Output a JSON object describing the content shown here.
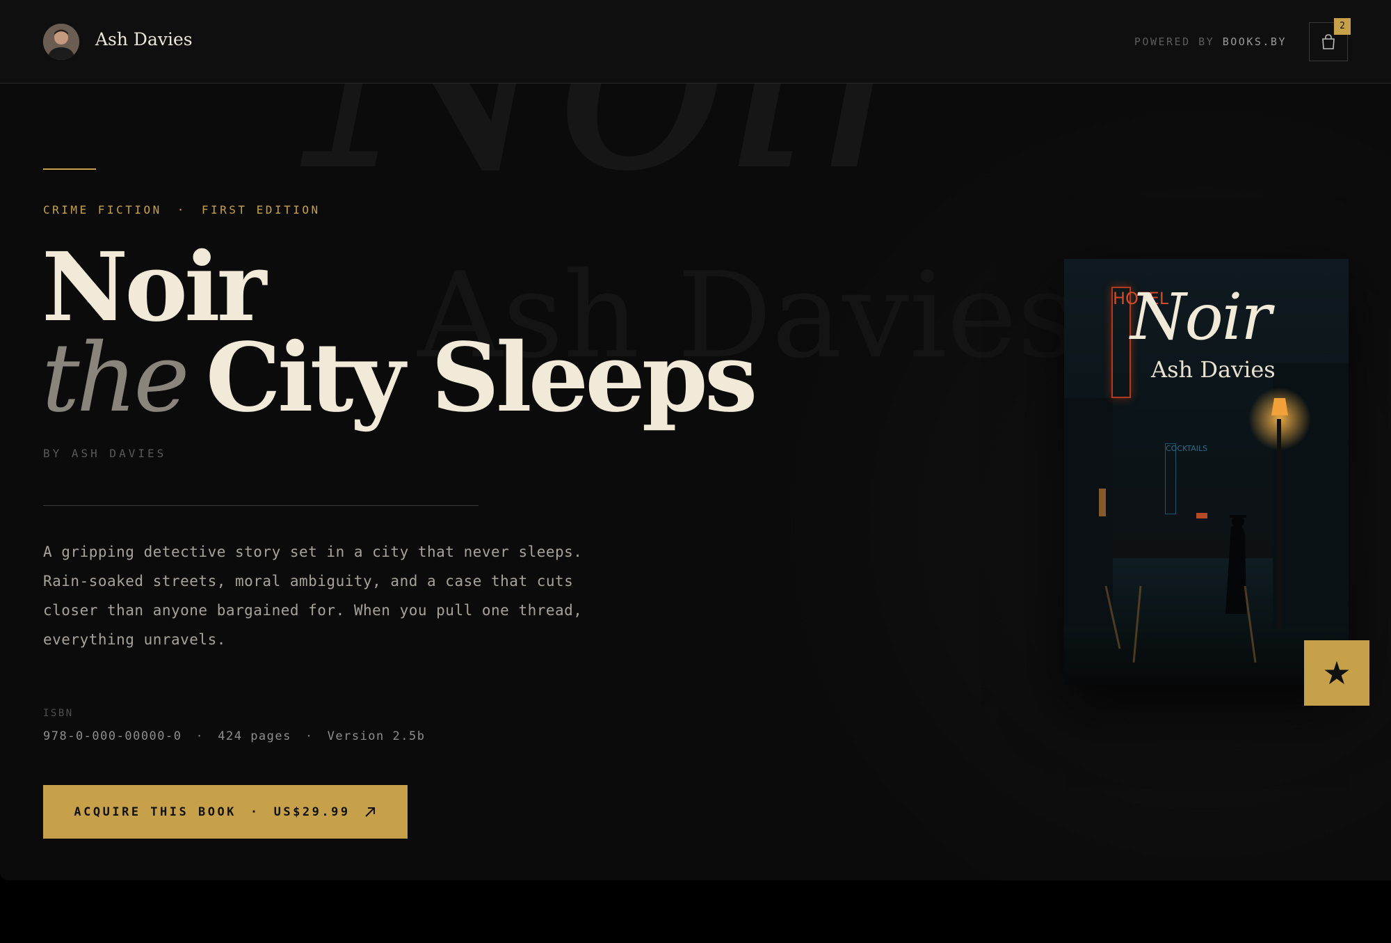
{
  "header": {
    "author_name": "Ash Davies",
    "powered_prefix": "POWERED BY ",
    "powered_brand": "BOOKS.BY",
    "cart_count": "2"
  },
  "watermark": {
    "title": "Noir",
    "author": "Ash Davies"
  },
  "hero": {
    "genre": "CRIME FICTION",
    "separator": "·",
    "edition": "FIRST EDITION",
    "title_line1": "Noir",
    "title_the": "the",
    "title_rest": "City Sleeps",
    "byline": "BY ASH DAVIES",
    "description": "A gripping detective story set in a city that never sleeps. Rain-soaked streets, moral ambiguity, and a case that cuts closer than anyone bargained for. When you pull one thread, everything unravels.",
    "isbn_label": "ISBN",
    "isbn": "978-0-000-00000-0",
    "pages": "424 pages",
    "version": "Version 2.5b",
    "cta_label": "ACQUIRE THIS BOOK",
    "cta_price": "US$29.99"
  },
  "cover": {
    "title": "Noir",
    "author": "Ash Davies",
    "neon_sign": "HOTEL",
    "side_sign": "COCKTAILS"
  },
  "colors": {
    "accent": "#c7a14a",
    "background": "#0b0b0b",
    "title_text": "#f1ead9"
  },
  "icons": {
    "cart": "shopping-bag-icon",
    "cta_arrow": "arrow-up-right-icon",
    "badge": "star-icon"
  }
}
